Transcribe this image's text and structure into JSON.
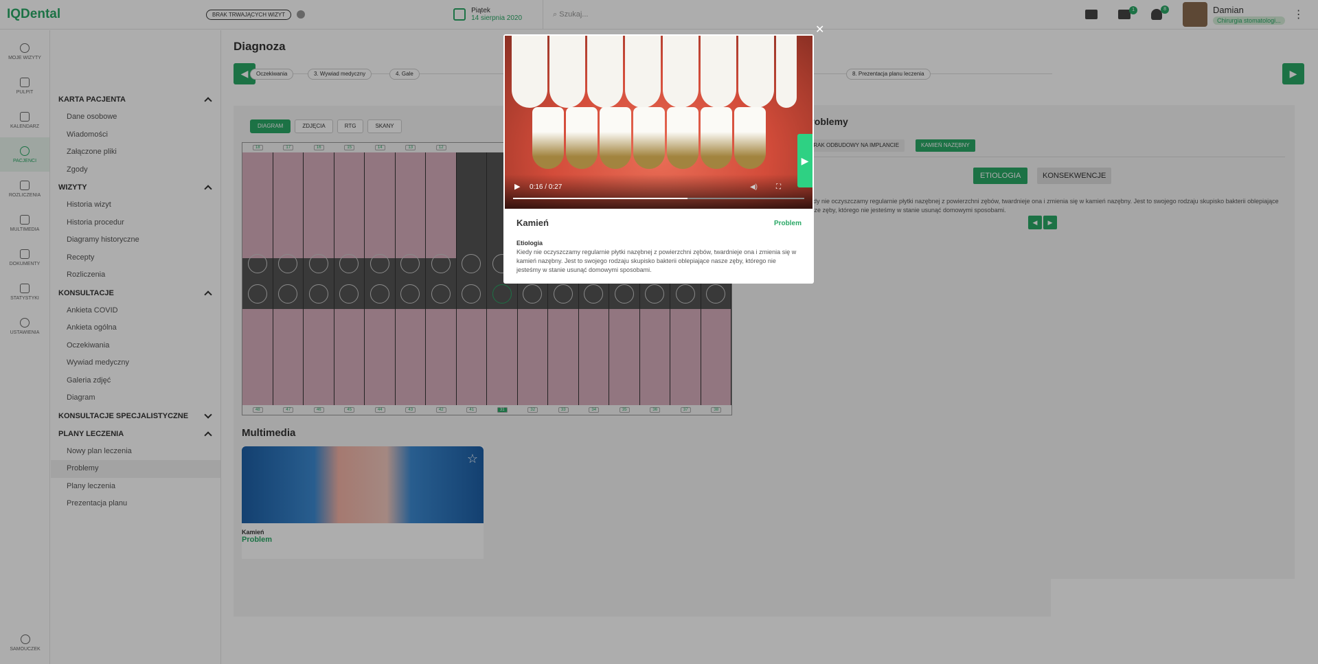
{
  "topbar": {
    "logo": "IQDental",
    "visit_badge": "BRAK TRWAJĄCYCH WIZYT",
    "date_day": "Piątek",
    "date_full": "14 sierpnia 2020",
    "search_placeholder": "Szukaj...",
    "notif_count_1": "1",
    "notif_count_2": "8",
    "user_name": "Damian",
    "user_role": "Chirurgia stomatologi..."
  },
  "leftbar": {
    "items": [
      {
        "label": "MOJE WIZYTY",
        "icon": "play-icon"
      },
      {
        "label": "PULPIT",
        "icon": "dashboard-icon"
      },
      {
        "label": "KALENDARZ",
        "icon": "calendar-icon"
      },
      {
        "label": "PACJENCI",
        "icon": "patients-icon"
      },
      {
        "label": "ROZLICZENIA",
        "icon": "card-icon"
      },
      {
        "label": "MULTIMEDIA",
        "icon": "multimedia-icon"
      },
      {
        "label": "DOKUMENTY",
        "icon": "document-icon"
      },
      {
        "label": "STATYSTYKI",
        "icon": "stats-icon"
      },
      {
        "label": "USTAWIENIA",
        "icon": "gear-icon"
      }
    ],
    "help": "SAMOUCZEK"
  },
  "menu": {
    "karta_head": "KARTA PACJENTA",
    "karta": [
      "Dane osobowe",
      "Wiadomości",
      "Załączone pliki",
      "Zgody"
    ],
    "wizyty_head": "WIZYTY",
    "wizyty": [
      "Historia wizyt",
      "Historia procedur",
      "Diagramy historyczne",
      "Recepty",
      "Rozliczenia"
    ],
    "kons_head": "KONSULTACJE",
    "kons": [
      "Ankieta COVID",
      "Ankieta ogólna",
      "Oczekiwania",
      "Wywiad medyczny",
      "Galeria zdjęć",
      "Diagram"
    ],
    "kons_spec_head": "KONSULTACJE SPECJALISTYCZNE",
    "plany_head": "PLANY LECZENIA",
    "plany": [
      "Nowy plan leczenia",
      "Problemy",
      "Plany leczenia",
      "Prezentacja planu"
    ]
  },
  "main": {
    "title": "Diagnoza",
    "steps": [
      "Oczekiwania",
      "3. Wywiad medyczny",
      "4. Gale",
      "8. Prezentacja planu leczenia"
    ],
    "tabs": [
      "DIAGRAM",
      "ZDJĘCIA",
      "RTG",
      "SKANY"
    ],
    "teeth_top_numbers": [
      "18",
      "17",
      "16",
      "15",
      "14",
      "13",
      "12"
    ],
    "teeth_bottom_numbers": [
      "48",
      "47",
      "46",
      "45",
      "44",
      "43",
      "42",
      "41",
      "31",
      "32",
      "33",
      "34",
      "35",
      "36",
      "37",
      "38"
    ],
    "multimedia_title": "Multimedia",
    "mm_name": "Kamień",
    "mm_status": "Problem"
  },
  "right": {
    "title": "Problemy",
    "tag1": "BRAK ODBUDOWY NA IMPLANCIE",
    "tag2": "KAMIEŃ NAZĘBNY",
    "btn_etiologia": "ETIOLOGIA",
    "btn_konsekwencje": "KONSEKWENCJE",
    "text": "Kiedy nie oczyszczamy regularnie płytki nazębnej z powierzchni zębów, twardnieje ona i zmienia się w kamień nazębny. Jest to swojego rodzaju skupisko bakterii oblepiające nasze zęby, którego nie jesteśmy w stanie usunąć domowymi sposobami."
  },
  "modal": {
    "video_time": "0:16 / 0:27",
    "video_progress": 0.6,
    "name": "Kamień",
    "status": "Problem",
    "etiol_head": "Etiologia",
    "etiol_text": "Kiedy nie oczyszczamy regularnie płytki nazębnej z powierzchni zębów, twardnieje ona i zmienia się w kamień nazębny. Jest to swojego rodzaju skupisko bakterii oblepiające nasze zęby, którego nie jesteśmy w stanie usunąć domowymi sposobami."
  },
  "colors": {
    "accent": "#2aa866",
    "overlay": "rgba(0,0,0,0.32)"
  }
}
